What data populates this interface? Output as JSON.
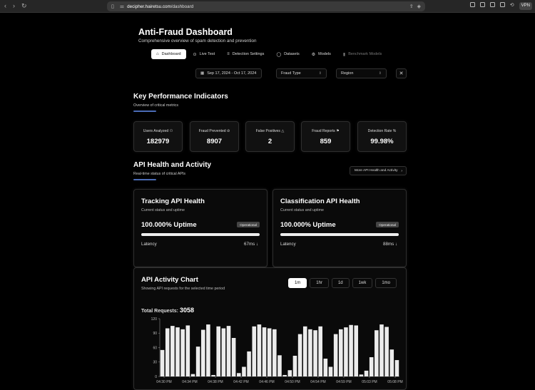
{
  "browser": {
    "url_host": "decipher.hairetsu.com",
    "url_path": "/dashboard",
    "vpn_label": "VPN"
  },
  "header": {
    "title": "Anti-Fraud Dashboard",
    "subtitle": "Comprehensive overview of spam detection and prevention"
  },
  "tabs": [
    {
      "label": "Dashboard",
      "icon": "home-icon",
      "state": "active"
    },
    {
      "label": "Live Test",
      "icon": "play-icon",
      "state": "normal"
    },
    {
      "label": "Detection Settings",
      "icon": "list-icon",
      "state": "normal"
    },
    {
      "label": "Datasets",
      "icon": "chat-icon",
      "state": "normal"
    },
    {
      "label": "Models",
      "icon": "gear-icon",
      "state": "normal"
    },
    {
      "label": "Benchmark Models",
      "icon": "bar-chart-icon",
      "state": "disabled"
    }
  ],
  "filters": {
    "date_range": "Sep 17, 2024 - Oct 17, 2024",
    "fraud_type": "Fraud Type",
    "region": "Region"
  },
  "kpi_section": {
    "title": "Key Performance Indicators",
    "subtitle": "Overview of critical metrics",
    "items": [
      {
        "label": "Users Analyzed",
        "value": "182979",
        "icon": "user-icon"
      },
      {
        "label": "Fraud Prevented",
        "value": "8907",
        "icon": "check-circle-icon"
      },
      {
        "label": "False Positives",
        "value": "2",
        "icon": "warning-icon"
      },
      {
        "label": "Fraud Reports",
        "value": "859",
        "icon": "flag-icon"
      },
      {
        "label": "Detection Rate",
        "value": "99.98%",
        "icon": "percent-icon"
      }
    ]
  },
  "api_section": {
    "title": "API Health and Activity",
    "subtitle": "Real-time status of critical APIs",
    "more_button": "More API Health and Activity",
    "cards": [
      {
        "title": "Tracking API Health",
        "subtitle": "Current status and uptime",
        "uptime": "100.000% Uptime",
        "uptime_fraction": 1.0,
        "status": "Operational",
        "latency_label": "Latency",
        "latency_value": "67ms"
      },
      {
        "title": "Classification API Health",
        "subtitle": "Current status and uptime",
        "uptime": "100.000% Uptime",
        "uptime_fraction": 1.0,
        "status": "Operational",
        "latency_label": "Latency",
        "latency_value": "88ms"
      }
    ]
  },
  "activity_chart": {
    "title": "API Activity Chart",
    "subtitle": "Showing API requests for the selected time period",
    "ranges": [
      "1m",
      "1hr",
      "1d",
      "1wk",
      "1mo"
    ],
    "active_range": "1m",
    "total_label": "Total Requests:",
    "total_value": "3058"
  },
  "chart_data": {
    "type": "bar",
    "title": "",
    "xlabel": "",
    "ylabel": "",
    "ylim": [
      0,
      120
    ],
    "yticks": [
      0,
      30,
      60,
      90,
      120
    ],
    "grid": false,
    "x_tick_labels": [
      "04:30 PM",
      "04:34 PM",
      "04:38 PM",
      "04:42 PM",
      "04:46 PM",
      "04:50 PM",
      "04:54 PM",
      "04:59 PM",
      "05:03 PM",
      "05:08 PM"
    ],
    "values": [
      55,
      100,
      105,
      102,
      98,
      106,
      5,
      62,
      97,
      108,
      3,
      104,
      100,
      105,
      80,
      7,
      20,
      52,
      104,
      108,
      102,
      100,
      98,
      44,
      3,
      13,
      43,
      88,
      104,
      98,
      96,
      104,
      37,
      20,
      88,
      98,
      102,
      107,
      106,
      4,
      12,
      40,
      96,
      108,
      103,
      56,
      34
    ]
  }
}
